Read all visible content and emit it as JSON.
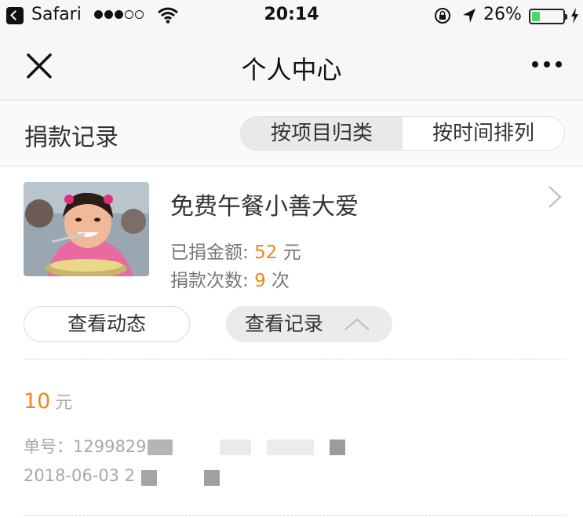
{
  "status_bar": {
    "app": "Safari",
    "time": "20:14",
    "battery_percent": "26%",
    "battery_level": 0.26,
    "signal_bars_filled": 3,
    "signal_bars_total": 5
  },
  "nav": {
    "title": "个人中心",
    "close_icon": "close-icon",
    "more_icon": "more-dots-icon"
  },
  "section": {
    "title": "捐款记录",
    "segments": [
      "按项目归类",
      "按时间排列"
    ],
    "active_segment": 0
  },
  "project": {
    "name": "免费午餐小善大爱",
    "amount_label": "已捐金额:",
    "amount_value": "52",
    "amount_unit": "元",
    "count_label": "捐款次数:",
    "count_value": "9",
    "count_unit": "次",
    "view_feed_label": "查看动态",
    "view_records_label": "查看记录"
  },
  "record": {
    "amount": "10",
    "unit": "元",
    "order": "单号：1299829",
    "date": "2018-06-03 2"
  },
  "colors": {
    "accent": "#f08519",
    "battery": "#4cd964",
    "bar_bg": "#f7f7f7"
  }
}
